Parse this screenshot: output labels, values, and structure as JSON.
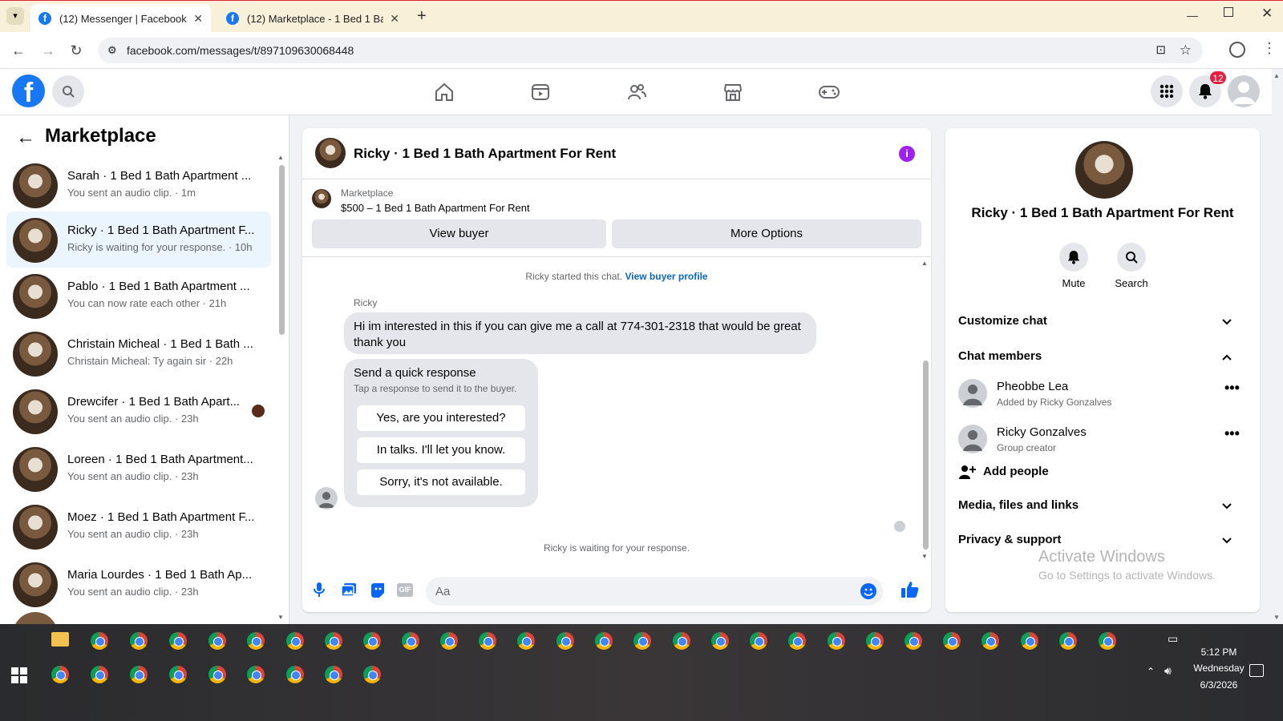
{
  "browser": {
    "tabs": [
      {
        "title": "(12) Messenger | Facebook",
        "active": true
      },
      {
        "title": "(12) Marketplace - 1 Bed 1 Bath",
        "active": false
      }
    ],
    "url": "facebook.com/messages/t/897109630068448"
  },
  "header": {
    "notification_count": "12"
  },
  "left": {
    "title": "Marketplace",
    "conversations": [
      {
        "name": "Sarah · 1 Bed 1 Bath Apartment ...",
        "sub": "You sent an audio clip. · 1m"
      },
      {
        "name": "Ricky · 1 Bed 1 Bath Apartment F...",
        "sub": "Ricky is waiting for your response. · 10h"
      },
      {
        "name": "Pablo · 1 Bed 1 Bath Apartment ...",
        "sub": "You can now rate each other · 21h"
      },
      {
        "name": "Christain Micheal · 1 Bed 1 Bath ...",
        "sub": "Christain Micheal: Ty again sir · 22h"
      },
      {
        "name": "Drewcifer · 1 Bed 1 Bath Apart...",
        "sub": "You sent an audio clip. · 23h"
      },
      {
        "name": "Loreen · 1 Bed 1 Bath Apartment...",
        "sub": "You sent an audio clip. · 23h"
      },
      {
        "name": "Moez · 1 Bed 1 Bath Apartment F...",
        "sub": "You sent an audio clip. · 23h"
      },
      {
        "name": "Maria Lourdes · 1 Bed 1 Bath Ap...",
        "sub": "You sent an audio clip. · 23h"
      }
    ]
  },
  "chat": {
    "title": "Ricky · 1 Bed 1 Bath Apartment For Rent",
    "listing_source": "Marketplace",
    "listing": "$500 – 1 Bed 1 Bath Apartment For Rent",
    "view_buyer": "View buyer",
    "more_options": "More Options",
    "started": "Ricky started this chat.",
    "view_profile": "View buyer profile",
    "sender": "Ricky",
    "message": "Hi im interested in this if you can give me a call at 774-301-2318 that would be great thank you",
    "quick_title": "Send a quick response",
    "quick_sub": "Tap a response to send it to the buyer.",
    "quick_responses": [
      "Yes, are you interested?",
      "In talks. I'll let you know.",
      "Sorry, it's not available."
    ],
    "waiting": "Ricky is waiting for your response.",
    "input_placeholder": "Aa"
  },
  "right": {
    "title": "Ricky · 1 Bed 1 Bath Apartment For Rent",
    "mute": "Mute",
    "search": "Search",
    "customize": "Customize chat",
    "members_label": "Chat members",
    "members": [
      {
        "name": "Pheobbe Lea",
        "role": "Added by Ricky Gonzalves"
      },
      {
        "name": "Ricky Gonzalves",
        "role": "Group creator"
      }
    ],
    "add_people": "Add people",
    "media": "Media, files and links",
    "privacy": "Privacy & support",
    "watermark1": "Activate Windows",
    "watermark2": "Go to Settings to activate Windows."
  },
  "taskbar": {
    "time": "5:12 PM",
    "day": "Wednesday",
    "date": "6/3/2026"
  }
}
